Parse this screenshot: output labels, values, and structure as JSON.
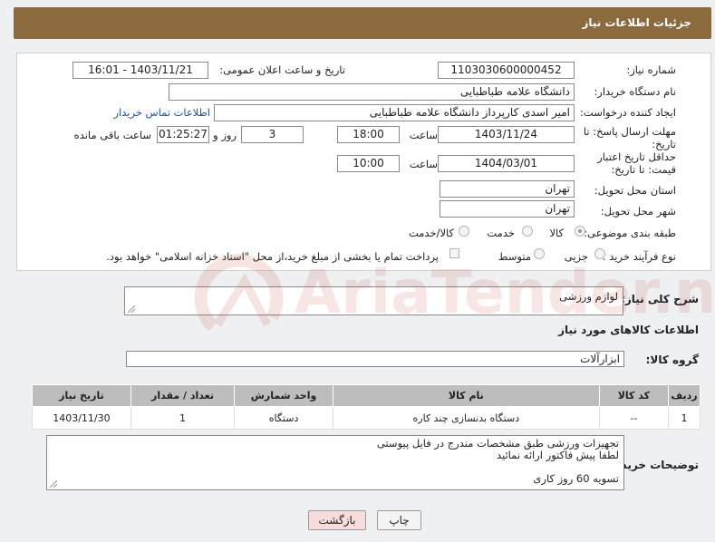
{
  "header": {
    "title": "جزئیات اطلاعات نیاز"
  },
  "form": {
    "need_number_label": "شماره نیاز:",
    "need_number": "1103030600000452",
    "announce_label": "تاریخ و ساعت اعلان عمومی:",
    "announce_value": "1403/11/21 - 16:01",
    "buyer_org_label": "نام دستگاه خریدار:",
    "buyer_org": "دانشگاه علامه طباطبایی",
    "creator_label": "ایجاد کننده درخواست:",
    "creator": "امیر اسدی کارپرداز دانشگاه علامه طباطبایی",
    "contact_link": "اطلاعات تماس خریدار",
    "deadline_label": "مهلت ارسال پاسخ: تا تاریخ:",
    "deadline_date": "1403/11/24",
    "time_label": "ساعت",
    "deadline_time": "18:00",
    "days_value": "3",
    "days_label": "روز و",
    "remaining_time": "01:25:27",
    "remaining_label": "ساعت باقی مانده",
    "price_valid_label": "حداقل تاریخ اعتبار قیمت: تا تاریخ:",
    "price_valid_date": "1404/03/01",
    "price_valid_time": "10:00",
    "province_label": "استان محل تحویل:",
    "province": "تهران",
    "city_label": "شهر محل تحویل:",
    "city": "تهران",
    "category_label": "طبقه بندی موضوعی:",
    "category_options": [
      "کالا",
      "خدمت",
      "کالا/خدمت"
    ],
    "process_label": "نوع فرآیند خرید :",
    "process_options": [
      "جزیی",
      "متوسط"
    ],
    "payment_note": "پرداخت تمام یا بخشی از مبلغ خرید،از محل \"اسناد خزانه اسلامی\" خواهد بود."
  },
  "description": {
    "label": "شرح کلی نیاز:",
    "value": "لوازم  ورزشی"
  },
  "items_section": {
    "title": "اطلاعات کالاهای مورد نیاز",
    "group_label": "گروه کالا:",
    "group_value": "ابزارآلات"
  },
  "table": {
    "headers": [
      "ردیف",
      "کد کالا",
      "نام کالا",
      "واحد شمارش",
      "تعداد / مقدار",
      "تاریخ نیاز"
    ],
    "rows": [
      [
        "1",
        "--",
        "دستگاه بدنسازی چند کاره",
        "دستگاه",
        "1",
        "1403/11/30"
      ]
    ]
  },
  "buyer_notes": {
    "label": "توضیحات خریدار:",
    "line1": "تجهیزات ورزشی طبق مشخصات مندرج در فایل پیوستی",
    "line2": "لطفا پیش فاکتور ارائه نمائید",
    "line3": "تسویه 60 روز کاری"
  },
  "buttons": {
    "print": "چاپ",
    "back": "بازگشت"
  },
  "watermark": {
    "text": "AriaTender.net"
  }
}
